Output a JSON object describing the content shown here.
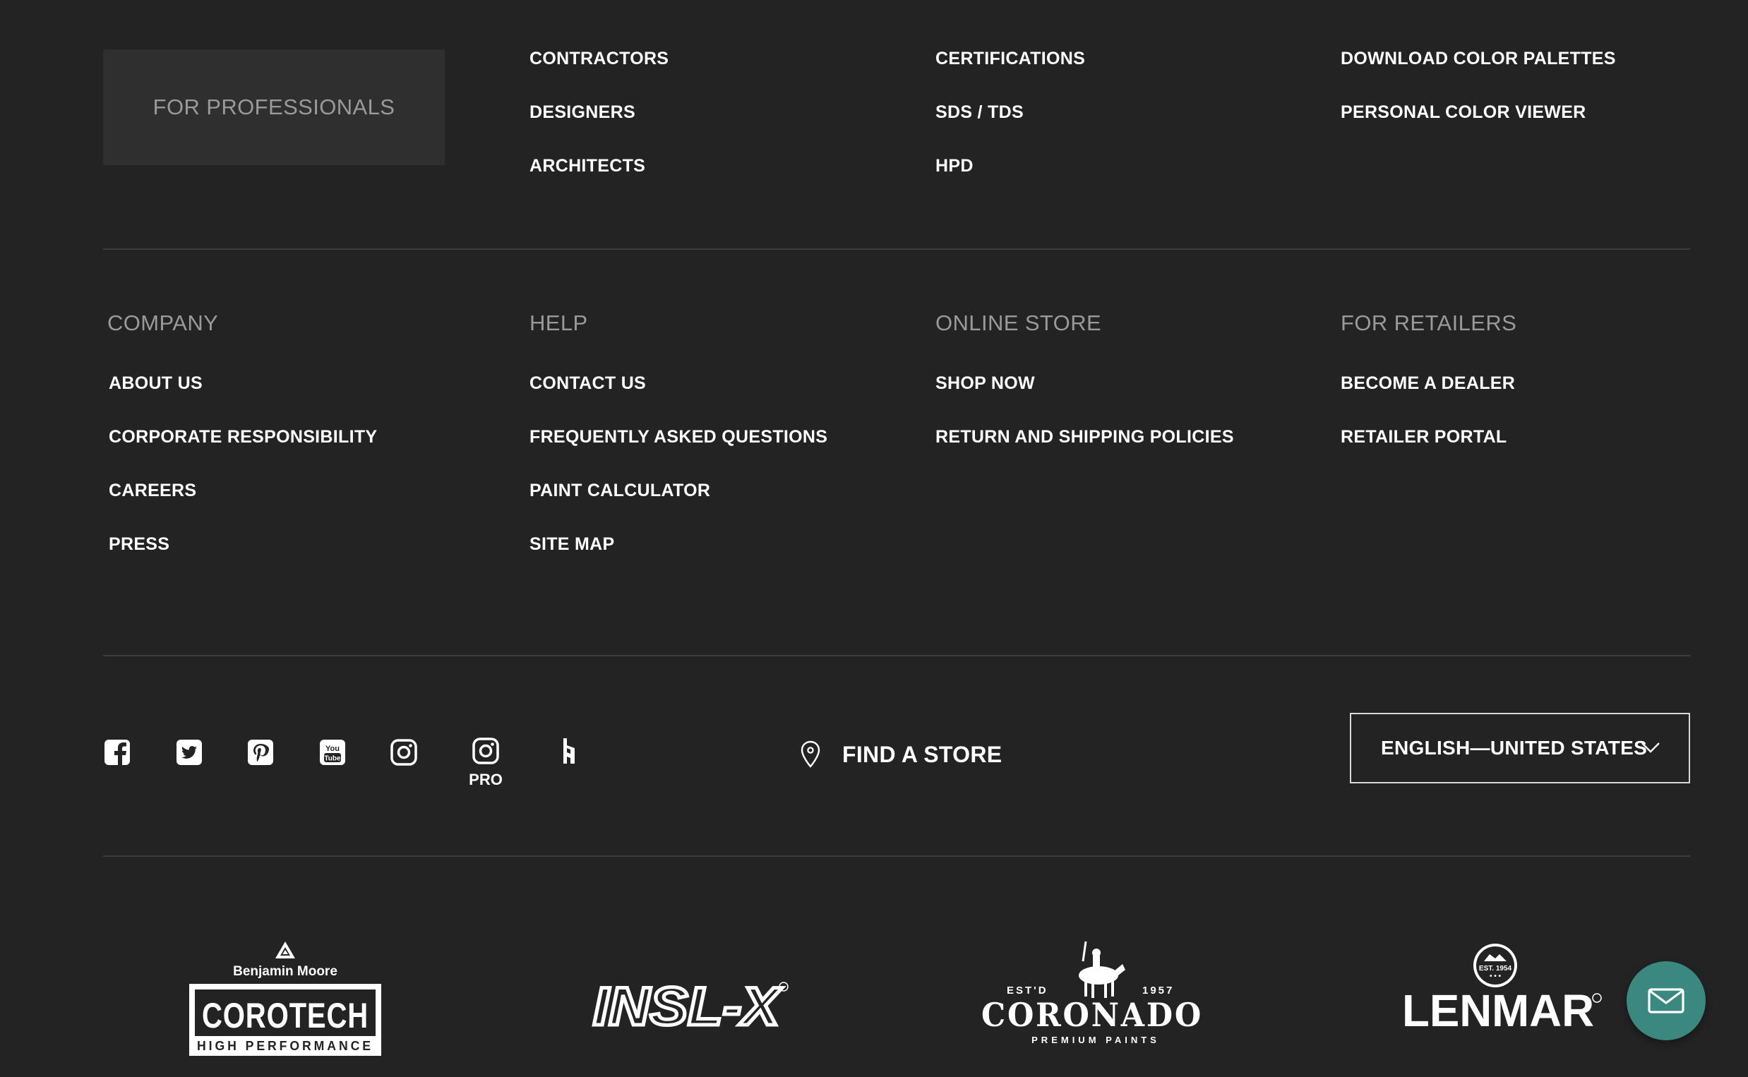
{
  "professionals": {
    "heading": "FOR PROFESSIONALS",
    "col1": [
      "CONTRACTORS",
      "DESIGNERS",
      "ARCHITECTS"
    ],
    "col2": [
      "CERTIFICATIONS",
      "SDS / TDS",
      "HPD"
    ],
    "col3": [
      "DOWNLOAD COLOR PALETTES",
      "PERSONAL COLOR VIEWER"
    ]
  },
  "company": {
    "heading": "COMPANY",
    "items": [
      "ABOUT US",
      "CORPORATE RESPONSIBILITY",
      "CAREERS",
      "PRESS"
    ]
  },
  "help": {
    "heading": "HELP",
    "items": [
      "CONTACT US",
      "FREQUENTLY ASKED QUESTIONS",
      "PAINT CALCULATOR",
      "SITE MAP"
    ]
  },
  "online_store": {
    "heading": "ONLINE STORE",
    "items": [
      "SHOP NOW",
      "RETURN AND SHIPPING POLICIES"
    ]
  },
  "retailers": {
    "heading": "FOR RETAILERS",
    "items": [
      "BECOME A DEALER",
      "RETAILER PORTAL"
    ]
  },
  "social": {
    "icons": [
      "facebook-icon",
      "twitter-icon",
      "pinterest-icon",
      "youtube-icon",
      "instagram-icon",
      "instagram-pro-icon",
      "houzz-icon"
    ],
    "youtube_text_1": "You",
    "youtube_text_2": "Tube",
    "pro_label": "PRO"
  },
  "store_locator": {
    "label": "FIND A STORE",
    "icon": "map-pin-icon"
  },
  "language": {
    "selected": "ENGLISH—UNITED STATES"
  },
  "brands": {
    "corotech": {
      "parent": "Benjamin Moore",
      "name": "COROTECH",
      "tagline": "HIGH PERFORMANCE"
    },
    "insl_x": {
      "name": "INSL-X"
    },
    "coronado": {
      "est": "EST'D",
      "year": "1957",
      "name": "CORONADO",
      "tagline": "PREMIUM PAINTS"
    },
    "lenmar": {
      "badge": "EST. 1954",
      "name": "LENMAR"
    }
  },
  "chat": {
    "icon": "envelope-icon"
  },
  "colors": {
    "background": "#232323",
    "panel": "#2f2f2f",
    "muted_text": "#9a9a9a",
    "accent_chat": "#3a8880"
  }
}
